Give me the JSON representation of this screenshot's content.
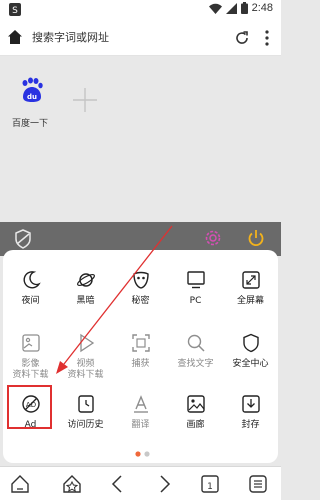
{
  "status": {
    "time": "2:48"
  },
  "address": {
    "placeholder": "搜索字词或网址"
  },
  "tiles": [
    {
      "label": "百度一下"
    }
  ],
  "menu_row1": [
    {
      "label": "夜间"
    },
    {
      "label": "黑暗"
    },
    {
      "label": "秘密"
    },
    {
      "label": "PC"
    },
    {
      "label": "全屏幕"
    }
  ],
  "menu_row2": [
    {
      "label1": "影像",
      "label2": "资料下载"
    },
    {
      "label1": "视频",
      "label2": "资料下载"
    },
    {
      "label1": "捕获",
      "label2": ""
    },
    {
      "label1": "查找文字",
      "label2": ""
    },
    {
      "label1": "安全中心",
      "label2": ""
    }
  ],
  "menu_row3": [
    {
      "label": "Ad"
    },
    {
      "label": "访问历史"
    },
    {
      "label": "翻译"
    },
    {
      "label": "画廊"
    },
    {
      "label": "封存"
    }
  ],
  "colors": {
    "accent_pink": "#d64fb5",
    "accent_yellow": "#f2b21c",
    "highlight_red": "#e03030"
  }
}
